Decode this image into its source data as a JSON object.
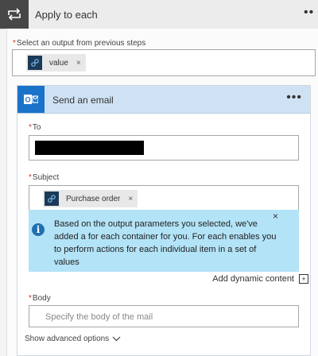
{
  "loop": {
    "title": "Apply to each",
    "more_label": "••",
    "select_label": "Select an output from previous steps",
    "required_mark": "*",
    "token": {
      "label": "value",
      "remove": "×"
    }
  },
  "action": {
    "title": "Send an email",
    "more_label": "•••",
    "to_label": "To",
    "subject_label": "Subject",
    "subject_token": {
      "label": "Purchase order",
      "remove": "×"
    },
    "info": {
      "text": "Based on the output parameters you selected, we've added a for each container for you. For each enables you to perform actions for each individual item in a set of values",
      "close": "×",
      "icon": "i"
    },
    "dynamic_link": "Add dynamic content",
    "dynamic_icon": "+",
    "body_label": "Body",
    "body_placeholder": "Specify the body of the mail",
    "advanced_label": "Show advanced options"
  },
  "colors": {
    "loop_header_icon_bg": "#474747",
    "action_header_bg": "#cfe2f3",
    "outlook_blue": "#1a73c9",
    "info_bg": "#b3e3f7",
    "token_icon_bg": "#1b3a57"
  }
}
